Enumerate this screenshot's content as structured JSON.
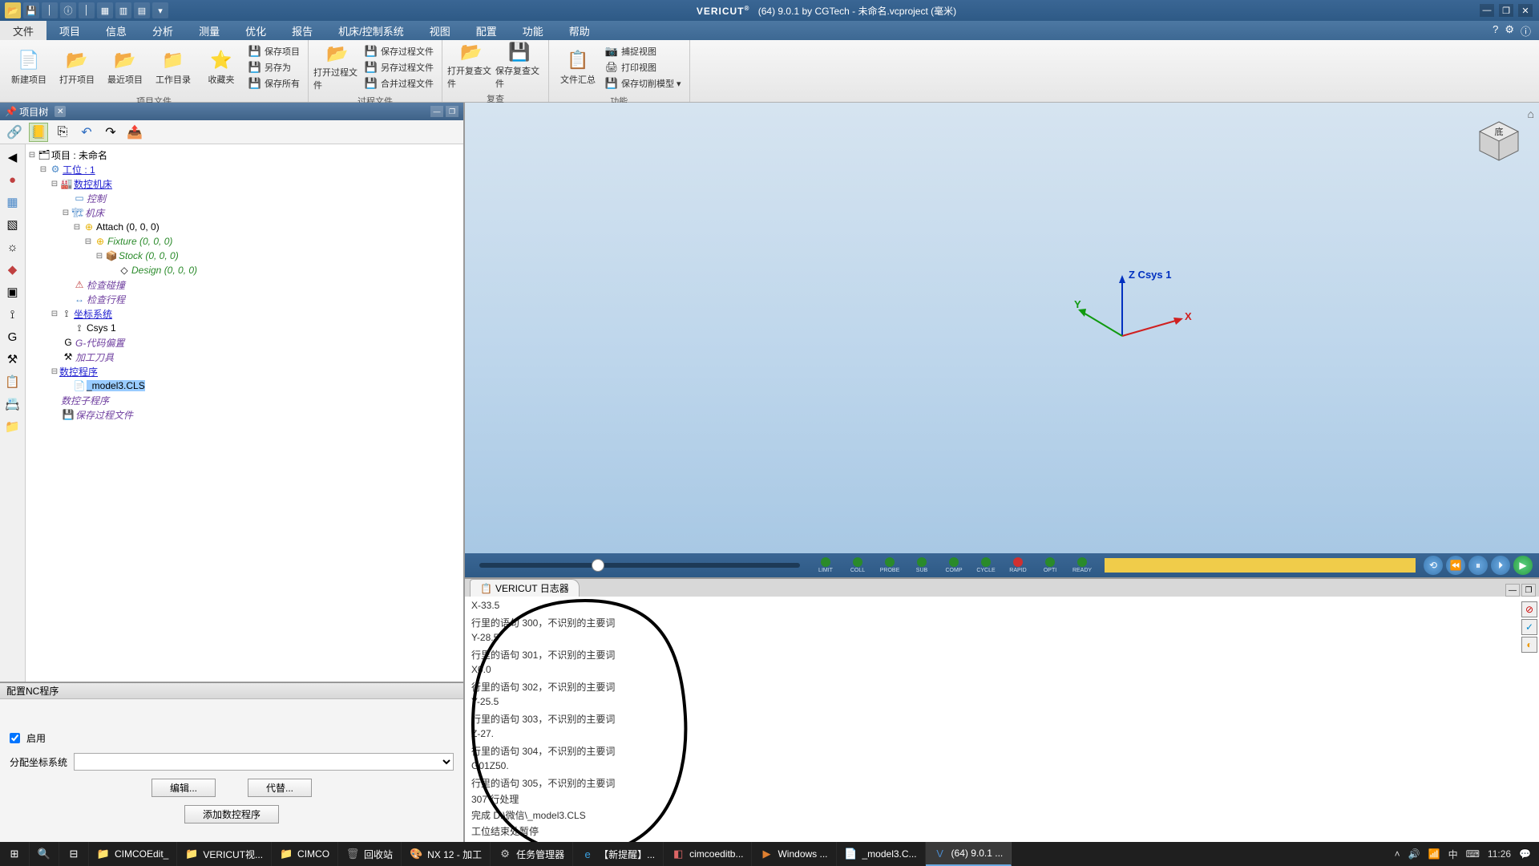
{
  "title": {
    "app": "VERICUT",
    "suffix": "(64)  9.0.1 by CGTech - 未命名.vcproject (毫米)"
  },
  "menu": [
    "文件",
    "项目",
    "信息",
    "分析",
    "测量",
    "优化",
    "报告",
    "机床/控制系统",
    "视图",
    "配置",
    "功能",
    "帮助"
  ],
  "activeMenu": 0,
  "ribbon": {
    "g1": {
      "label": "项目文件",
      "big": [
        "新建项目",
        "打开项目",
        "最近项目",
        "工作目录",
        "收藏夹"
      ],
      "small": [
        "保存项目",
        "另存为",
        "保存所有"
      ]
    },
    "g2": {
      "label": "过程文件",
      "big": [
        "打开过程文件"
      ],
      "small": [
        "保存过程文件",
        "另存过程文件",
        "合并过程文件"
      ]
    },
    "g3": {
      "label": "复查",
      "big": [
        "打开复查文件",
        "保存复查文件"
      ]
    },
    "g4": {
      "label": "功能",
      "big": [
        "文件汇总"
      ],
      "small": [
        "捕捉视图",
        "打印视图",
        "保存切削模型 ▾"
      ]
    }
  },
  "projTree": {
    "title": "项目树",
    "root": "项目 : 未命名",
    "setup": "工位 : 1",
    "cnc": "数控机床",
    "control": "控制",
    "machine": "机床",
    "attach": "Attach (0, 0, 0)",
    "fixture": "Fixture (0, 0, 0)",
    "stock": "Stock (0, 0, 0)",
    "design": "Design (0, 0, 0)",
    "collision": "检查碰撞",
    "travel": "检查行程",
    "csys": "坐标系统",
    "csys1": "Csys 1",
    "goffset": "G-代码偏置",
    "tooling": "加工刀具",
    "ncprog": "数控程序",
    "ncfile": "_model3.CLS",
    "ncsub": "数控子程序",
    "ipfile": "保存过程文件"
  },
  "config": {
    "title": "配置NC程序",
    "enable": "启用",
    "allocCsys": "分配坐标系统",
    "btnEdit": "编辑...",
    "btnSubst": "代替...",
    "btnAdd": "添加数控程序"
  },
  "csysLabel": "Z Csys 1",
  "playback": {
    "indicators": [
      "LIMIT",
      "COLL",
      "PROBE",
      "SUB",
      "COMP",
      "CYCLE",
      "RAPID",
      "OPTI",
      "READY"
    ]
  },
  "log": {
    "tab": "VERICUT 日志器",
    "lines": [
      "X-33.5",
      "行里的语句 300，不识别的主要词",
      "Y-28.5",
      "行里的语句 301，不识别的主要词",
      "X0.0",
      "行里的语句 302，不识别的主要词",
      "Y-25.5",
      "行里的语句 303，不识别的主要词",
      "Z-27.",
      "行里的语句 304，不识别的主要词",
      "G01Z50.",
      "行里的语句 305，不识别的主要词",
      "307 行处理",
      "完成 D:\\微信\\_model3.CLS",
      "工位结束处暂停"
    ]
  },
  "taskbar": {
    "items": [
      {
        "icon": "📁",
        "label": "CIMCOEdit_",
        "color": "#e6b000"
      },
      {
        "icon": "📁",
        "label": "VERICUT视...",
        "color": "#e6b000"
      },
      {
        "icon": "📁",
        "label": "CIMCO",
        "color": "#e6b000"
      },
      {
        "icon": "🗑",
        "label": "回收站",
        "color": "#888"
      },
      {
        "icon": "🎨",
        "label": "NX 12 - 加工",
        "color": "#6ac"
      },
      {
        "icon": "⚙",
        "label": "任务管理器",
        "color": "#ccc"
      },
      {
        "icon": "e",
        "label": "【新提醒】...",
        "color": "#3aa0e0"
      },
      {
        "icon": "◧",
        "label": "cimcoeditb...",
        "color": "#d66"
      },
      {
        "icon": "▶",
        "label": "Windows ...",
        "color": "#e08030"
      },
      {
        "icon": "📄",
        "label": "_model3.C...",
        "color": "#bbb"
      },
      {
        "icon": "V",
        "label": "(64)  9.0.1 ...",
        "color": "#4a88c8",
        "active": true
      }
    ],
    "time": "11:26"
  }
}
